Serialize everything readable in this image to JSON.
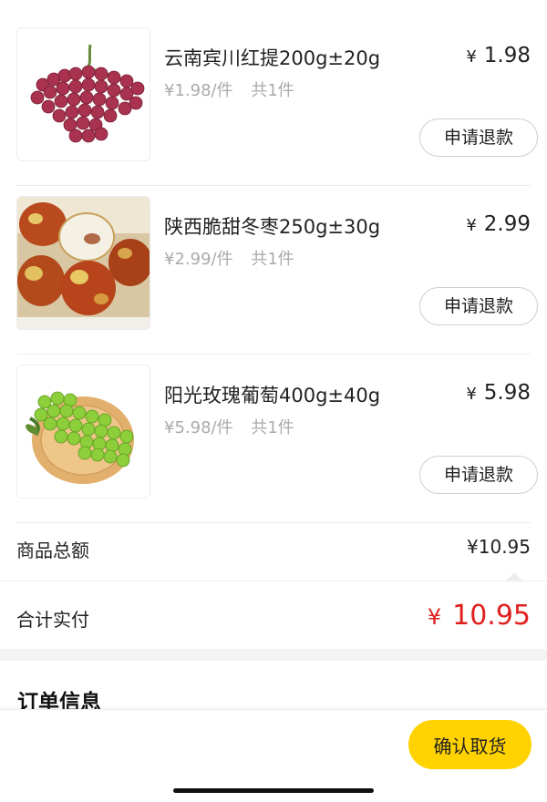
{
  "items": [
    {
      "name": "云南宾川红提200g±20g",
      "unit_price": "¥1.98/件",
      "count": "共1件",
      "price_symbol": "¥",
      "price": "1.98",
      "refund_label": "申请退款",
      "image_icon": "red-grapes-image"
    },
    {
      "name": "陕西脆甜冬枣250g±30g",
      "unit_price": "¥2.99/件",
      "count": "共1件",
      "price_symbol": "¥",
      "price": "2.99",
      "refund_label": "申请退款",
      "image_icon": "winter-jujube-image"
    },
    {
      "name": "阳光玫瑰葡萄400g±40g",
      "unit_price": "¥5.98/件",
      "count": "共1件",
      "price_symbol": "¥",
      "price": "5.98",
      "refund_label": "申请退款",
      "image_icon": "green-grapes-image"
    }
  ],
  "summary": {
    "subtotal_label": "商品总额",
    "subtotal_value": "¥10.95",
    "total_label": "合计实付",
    "total_symbol": "¥",
    "total_value": "10.95"
  },
  "order_info": {
    "title": "订单信息"
  },
  "footer": {
    "confirm_label": "确认取货"
  },
  "colors": {
    "accent": "#ffd200",
    "total_price": "#e02020",
    "muted_text": "#aaaaaa"
  }
}
